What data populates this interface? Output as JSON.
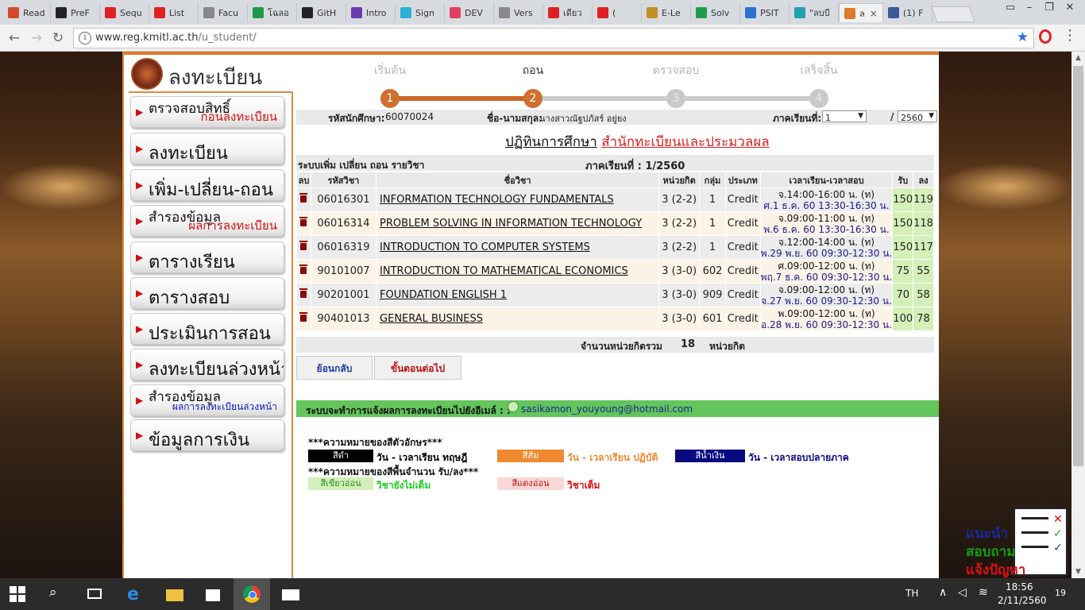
{
  "browser": {
    "tabs": [
      {
        "label": "Read",
        "color": "#d24a2a"
      },
      {
        "label": "PreF",
        "color": "#222222"
      },
      {
        "label": "Sequ",
        "color": "#e02020"
      },
      {
        "label": "List",
        "color": "#e02020"
      },
      {
        "label": "Facu",
        "color": "#888888"
      },
      {
        "label": "โฉลอ",
        "color": "#1f9a4a"
      },
      {
        "label": "GitH",
        "color": "#222222"
      },
      {
        "label": "Intro",
        "color": "#6a3ab0"
      },
      {
        "label": "Sign",
        "color": "#2ab0d0"
      },
      {
        "label": "DEV",
        "color": "#e04060"
      },
      {
        "label": "Vers",
        "color": "#888888"
      },
      {
        "label": "เดียว",
        "color": "#e02020"
      },
      {
        "label": "(",
        "color": "#e02020"
      },
      {
        "label": "E-Le",
        "color": "#c09020"
      },
      {
        "label": "Solv",
        "color": "#1f9a4a"
      },
      {
        "label": "PSIT",
        "color": "#2a70d0"
      },
      {
        "label": "\"ลบบี",
        "color": "#20a0b0"
      },
      {
        "label": "ล",
        "color": "#e07a2a"
      },
      {
        "label": "(1) F",
        "color": "#3b5998"
      }
    ],
    "active_tab_close": "×",
    "url_host": "www.reg.kmitl.ac.th",
    "url_path": "/u_student/"
  },
  "sidebar": {
    "logo_text": "ลงทะเบียน",
    "items": [
      {
        "label": "ตรวจสอบสิทธิ์",
        "sub": "ก่อนลงทะเบียน"
      },
      {
        "label": "ลงทะเบียน"
      },
      {
        "label": "เพิ่ม-เปลี่ยน-ถอน"
      },
      {
        "label": "สำรองข้อมูล",
        "sub": "ผลการลงทะเบียน"
      },
      {
        "label": "ตารางเรียน"
      },
      {
        "label": "ตารางสอบ"
      },
      {
        "label": "ประเมินการสอน"
      },
      {
        "label": "ลงทะเบียนล่วงหน้า"
      },
      {
        "label": "สำรองข้อมูล",
        "sub": "ผลการลงทะเบียนล่วงหน้า"
      },
      {
        "label": "ข้อมูลการเงิน"
      }
    ]
  },
  "steps": [
    {
      "label": "เริ่มต้น",
      "num": "1"
    },
    {
      "label": "ถอน",
      "num": "2"
    },
    {
      "label": "ตรวจสอบ",
      "num": "3"
    },
    {
      "label": "เสร็จสิ้น",
      "num": "4"
    }
  ],
  "student": {
    "id_label": "รหัสนักศึกษา:",
    "id": "60070024",
    "name_label": "ชื่อ-นามสกุล:",
    "name": "นางสาวณัฐปภัสร์ อยู่ยง",
    "term_label": "ภาคเรียนที่:",
    "term": "1",
    "slash": "/",
    "year": "2560"
  },
  "page_title": {
    "left": "ปฏิทินการศึกษา",
    "right": "สำนักทะเบียนและประมวลผล"
  },
  "table": {
    "caption_left": "ระบบเพิ่ม เปลี่ยน ถอน รายวิชา",
    "caption_right": "ภาคเรียนที่ : 1/2560",
    "headers": [
      "ลบ",
      "รหัสวิชา",
      "ชื่อวิชา",
      "หน่วยกิต",
      "กลุ่ม",
      "ประเภท",
      "เวลาเรียน-เวลาสอบ",
      "รับ",
      "ลง"
    ],
    "rows": [
      {
        "code": "06016301",
        "name": "INFORMATION TECHNOLOGY FUNDAMENTALS",
        "credit": "3 (2-2)",
        "group": "1",
        "type": "Credit",
        "time": "จ.14:00-16:00 น. (ท)",
        "exam": "ศ.1 ธ.ค. 60 13:30-16:30 น.",
        "cap": "150",
        "enrolled": "119"
      },
      {
        "code": "06016314",
        "name": "PROBLEM SOLVING IN INFORMATION TECHNOLOGY",
        "credit": "3 (2-2)",
        "group": "1",
        "type": "Credit",
        "time": "จ.09:00-11:00 น. (ท)",
        "exam": "พ.6 ธ.ค. 60 13:30-16:30 น.",
        "cap": "150",
        "enrolled": "118"
      },
      {
        "code": "06016319",
        "name": "INTRODUCTION TO COMPUTER SYSTEMS",
        "credit": "3 (2-2)",
        "group": "1",
        "type": "Credit",
        "time": "จ.12:00-14:00 น. (ท)",
        "exam": "พ.29 พ.ย. 60 09:30-12:30 น.",
        "cap": "150",
        "enrolled": "117"
      },
      {
        "code": "90101007",
        "name": "INTRODUCTION TO MATHEMATICAL ECONOMICS",
        "credit": "3 (3-0)",
        "group": "602",
        "type": "Credit",
        "time": "ศ.09:00-12:00 น. (ท)",
        "exam": "พฤ.7 ธ.ค. 60 09:30-12:30 น.",
        "cap": "75",
        "enrolled": "55"
      },
      {
        "code": "90201001",
        "name": "FOUNDATION ENGLISH 1",
        "credit": "3 (3-0)",
        "group": "909",
        "type": "Credit",
        "time": "จ.09:00-12:00 น. (ท)",
        "exam": "จ.27 พ.ย. 60 09:30-12:30 น.",
        "cap": "70",
        "enrolled": "58"
      },
      {
        "code": "90401013",
        "name": "GENERAL BUSINESS",
        "credit": "3 (3-0)",
        "group": "601",
        "type": "Credit",
        "time": "พ.09:00-12:00 น. (ท)",
        "exam": "อ.28 พ.ย. 60 09:30-12:30 น.",
        "cap": "100",
        "enrolled": "78"
      }
    ],
    "total_label": "จำนวนหน่วยกิตรวม",
    "total_value": "18",
    "total_unit": "หน่วยกิต"
  },
  "buttons": {
    "back": "ย้อนกลับ",
    "next": "ขั้นตอนต่อไป"
  },
  "notice": {
    "label": "ระบบจะทำการแจ้งผลการลงทะเบียนไปยังอีเมล์ : :",
    "email": "sasikamon_youyoung@hotmail.com"
  },
  "legend": {
    "title1": "***ความหมายของสีตัวอักษร***",
    "title2": "***ความหมายของสีพื้นจำนวน รับ/ลง***",
    "items": [
      {
        "swatch": "สีดำ",
        "desc": "วัน - เวลาเรียน ทฤษฎี",
        "bg": "#000000",
        "fg": "#ffffff",
        "descColor": "#000000"
      },
      {
        "swatch": "สีส้ม",
        "desc": "วัน - เวลาเรียน ปฏิบัติ",
        "bg": "#f08a30",
        "fg": "#ffffff",
        "descColor": "#f08a30"
      },
      {
        "swatch": "สีน้ำเงิน",
        "desc": "วัน - เวลาสอบปลายภาค",
        "bg": "#0a0a80",
        "fg": "#ffffff",
        "descColor": "#0a0a80"
      },
      {
        "swatch": "สีเขียวอ่อน",
        "desc": "วิชายังไม่เต็ม",
        "bg": "#d5efb8",
        "fg": "#2a8a2a",
        "descColor": "#22cc22"
      },
      {
        "swatch": "สีแดงอ่อน",
        "desc": "วิชาเต็ม",
        "bg": "#f8d8d8",
        "fg": "#c01010",
        "descColor": "#e01010"
      }
    ]
  },
  "widget": {
    "line1": "แนะนำ",
    "line2": "สอบถาม",
    "line3": "แจ้งปัญหา"
  },
  "taskbar": {
    "lang": "TH",
    "time": "18:56",
    "date": "2/11/2560",
    "notif": "19"
  }
}
